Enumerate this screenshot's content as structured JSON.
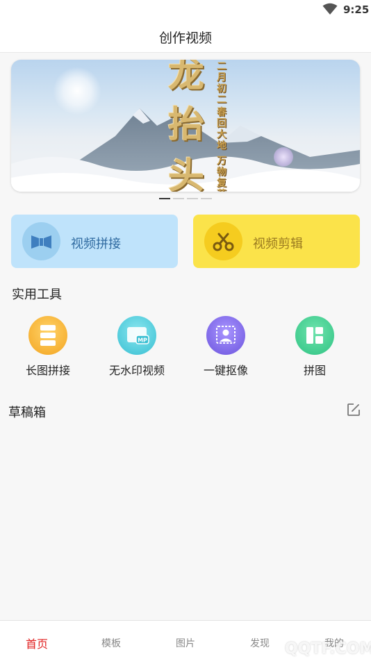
{
  "status_bar": {
    "time": "9:25",
    "wifi_icon": "wifi-icon"
  },
  "header": {
    "title": "创作视频"
  },
  "banner": {
    "big_chars": [
      "龙",
      "抬",
      "头"
    ],
    "vertical_text_1": "二月初二",
    "vertical_text_2": "春回大地",
    "vertical_text_3": "万物复苏",
    "page_count": 4,
    "active_page": 1
  },
  "actions": {
    "video_join": {
      "label": "视频拼接",
      "icon": "video-join-icon"
    },
    "video_edit": {
      "label": "视频剪辑",
      "icon": "scissors-icon"
    }
  },
  "tools": {
    "title": "实用工具",
    "items": [
      {
        "label": "长图拼接",
        "icon": "long-image-icon",
        "color": "#f8b435"
      },
      {
        "label": "无水印视频",
        "icon": "mp-video-icon",
        "color": "#4fc8da"
      },
      {
        "label": "一键抠像",
        "icon": "portrait-cutout-icon",
        "color": "#7a63e8"
      },
      {
        "label": "拼图",
        "icon": "collage-icon",
        "color": "#3ccf8e"
      }
    ]
  },
  "drafts": {
    "title": "草稿箱",
    "edit_icon": "edit-icon"
  },
  "tabbar": {
    "items": [
      {
        "label": "首页",
        "active": true
      },
      {
        "label": "模板",
        "active": false
      },
      {
        "label": "图片",
        "active": false
      },
      {
        "label": "发现",
        "active": false
      },
      {
        "label": "我的",
        "active": false
      }
    ]
  },
  "watermark": "QQTF.COM",
  "colors": {
    "accent_red": "#e02020",
    "join_bg": "#bfe3fb",
    "edit_bg": "#fbe34a"
  }
}
